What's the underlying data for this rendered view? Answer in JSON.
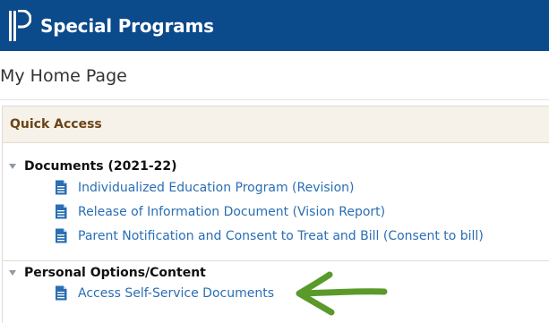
{
  "header": {
    "app_title": "Special Programs",
    "logo_icon": "powerschool-p-logo-icon",
    "background_color": "#0b4a8b"
  },
  "page": {
    "title": "My Home Page"
  },
  "quick_access": {
    "title": "Quick Access",
    "sections": [
      {
        "title": "Documents (2021-22)",
        "expand_icon": "triangle-down-icon",
        "links": [
          {
            "label": "Individualized Education Program (Revision)",
            "icon": "document-icon"
          },
          {
            "label": "Release of Information Document (Vision Report)",
            "icon": "document-icon"
          },
          {
            "label": "Parent Notification and Consent to Treat and Bill (Consent to bill)",
            "icon": "document-icon"
          }
        ]
      },
      {
        "title": "Personal Options/Content",
        "expand_icon": "triangle-down-icon",
        "links": [
          {
            "label": "Access Self-Service Documents",
            "icon": "document-icon"
          }
        ]
      }
    ]
  },
  "annotation": {
    "icon": "green-arrow-icon",
    "color": "#5a9a2a"
  }
}
